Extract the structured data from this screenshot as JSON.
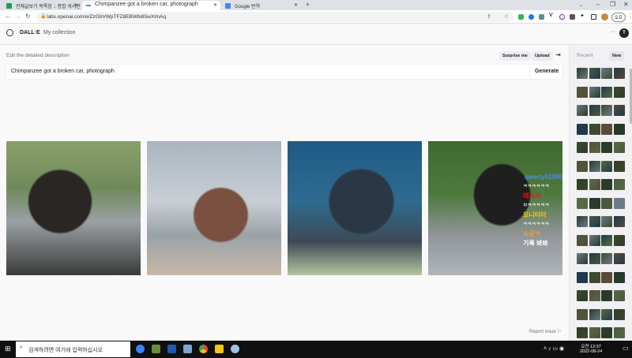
{
  "browser": {
    "tabs": [
      {
        "title": "전체글보기 목록짐 :: 종합 게시판",
        "fav": "#1aa34a"
      },
      {
        "title": "Chimpanzee got a broken car, photograph",
        "fav": "#d946ef"
      },
      {
        "title": "Google 번역",
        "fav": "#4285f4"
      }
    ],
    "new_tab": "+",
    "url": "labs.openai.com/e/ZzGbVWpTFZ8EBWbi85wXlmAq",
    "profile": "오프"
  },
  "app": {
    "brand": "DALL·E",
    "nav_collection": "My collection",
    "avatar": "T",
    "more": "···"
  },
  "editor": {
    "label": "Edit the detailed description",
    "surprise": "Surprise me",
    "upload": "Upload",
    "prompt": "Chimpanzee got a broken car, photograph",
    "generate": "Generate",
    "report": "Report issue"
  },
  "images": [
    {
      "alt": "Chimpanzee leaning over car hood",
      "colors": [
        "#6f8a5a",
        "#3a3530",
        "#9aa0a4"
      ]
    },
    {
      "alt": "Chimpanzee inspecting open hood",
      "colors": [
        "#c9ced4",
        "#6b4a3a",
        "#d8d2cc"
      ]
    },
    {
      "alt": "Chimpanzee climbing out of car door",
      "colors": [
        "#2f6b8f",
        "#2b3744",
        "#b6c4a0"
      ]
    },
    {
      "alt": "Chimpanzee holding car door",
      "colors": [
        "#4f7a3e",
        "#222",
        "#b0b5b8"
      ]
    }
  ],
  "overlay": [
    "qwerty51590",
    "ㅋㅋㅋㅋㅋㅋ",
    "레시기",
    "ㅁㅋㅋㅋㅋㅋ",
    "모니터터",
    "ㅋㅋㅋㅋㅋㅋ",
    "소금ㅋ",
    "기록 봐봐"
  ],
  "sidebar": {
    "title": "Recent",
    "new": "New"
  },
  "taskbar": {
    "search": "검색하려면 여기에 입력하십시오",
    "time": "오전 12:37",
    "date": "2022-08-24"
  }
}
